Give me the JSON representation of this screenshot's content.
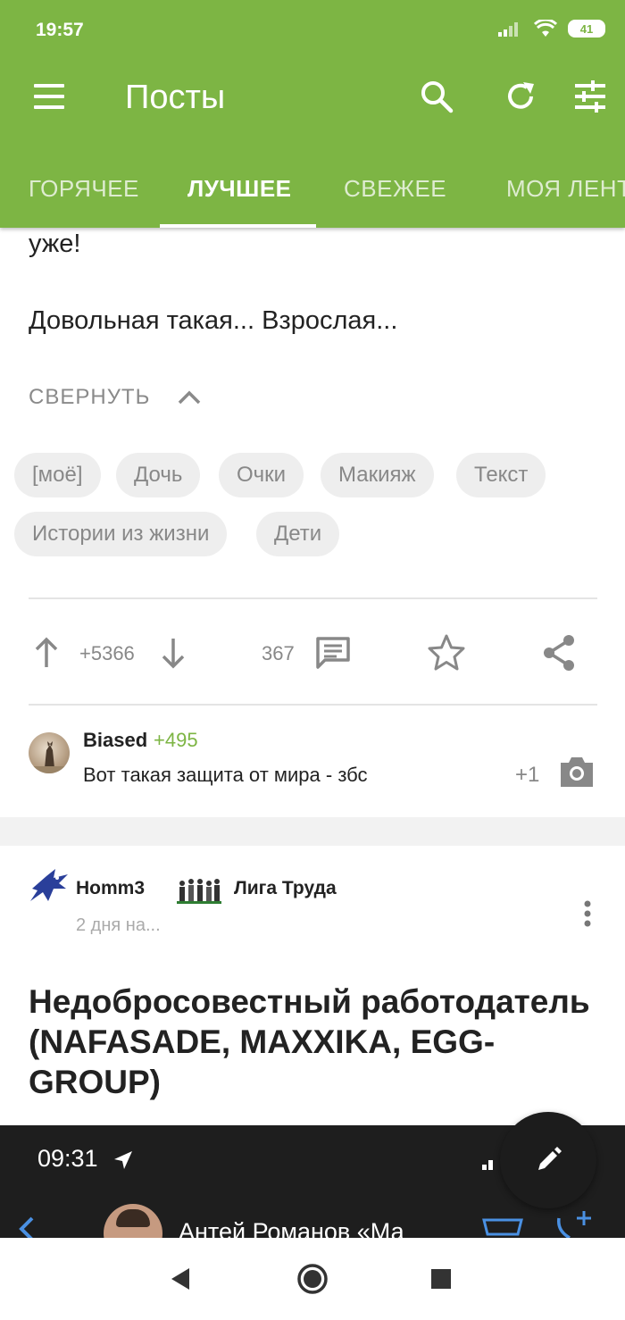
{
  "status_bar": {
    "time": "19:57",
    "battery": "41"
  },
  "header": {
    "title": "Посты",
    "tabs": [
      {
        "label": "ГОРЯЧЕЕ"
      },
      {
        "label": "ЛУЧШЕЕ",
        "active": true
      },
      {
        "label": "СВЕЖЕЕ"
      },
      {
        "label": "МОЯ ЛЕНТ"
      }
    ]
  },
  "post1": {
    "text_lines": [
      "уже!",
      "Довольная такая... Взрослая..."
    ],
    "collapse_label": "СВЕРНУТЬ",
    "tags": [
      "[моё]",
      "Дочь",
      "Очки",
      "Макияж",
      "Текст",
      "Истории из жизни",
      "Дети"
    ],
    "rating": "+5366",
    "comments_count": "367",
    "top_comment": {
      "author": "Biased",
      "author_rating": "+495",
      "text": "Вот такая защита от мира - збс",
      "rating": "+1"
    }
  },
  "post2": {
    "communities": [
      "Homm3",
      "Лига Труда"
    ],
    "time_ago": "2 дня на...",
    "title": "Недобросовестный работодатель (NAFASADE, MAXXIKA, EGG-GROUP)",
    "image_preview": {
      "time": "09:31",
      "contact_name": "Антей Романов «Ма"
    }
  },
  "colors": {
    "brand": "#7db544",
    "comment_rating": "#7db544"
  }
}
